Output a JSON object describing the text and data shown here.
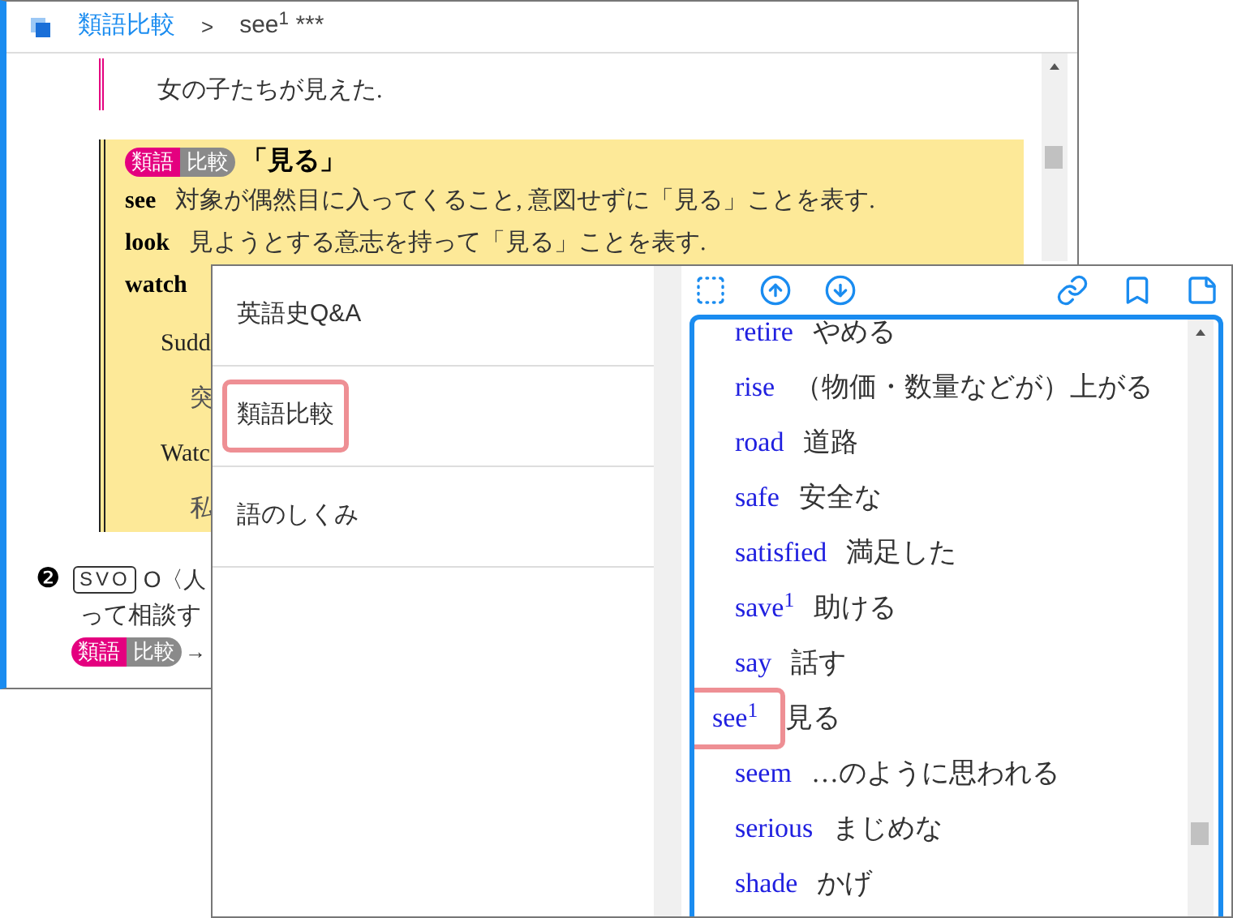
{
  "back_window": {
    "breadcrumb": {
      "parent": "類語比較",
      "separator": ">",
      "current": "see$^{1}$ ***"
    },
    "example_line": "女の子たちが見えた.",
    "comparison": {
      "badge": {
        "left": "類語",
        "right": "比較"
      },
      "title": "「見る」",
      "rows": [
        {
          "word": "see",
          "text": "対象が偶然目に入ってくること, 意図せずに「見る」ことを表す."
        },
        {
          "word": "look",
          "text": "見ようとする意志を持って「見る」ことを表す."
        },
        {
          "word": "watch",
          "text": ""
        }
      ],
      "examples": [
        {
          "text": "Sudd",
          "kind": "english"
        },
        {
          "text": "突",
          "kind": "japanese"
        },
        {
          "text": "Watc",
          "kind": "english"
        },
        {
          "text": "私",
          "kind": "japanese"
        }
      ]
    },
    "sense": {
      "number": "❷",
      "pattern": "SVO",
      "line1": "O〈人",
      "line2": "って相談す",
      "badge": {
        "left": "類語",
        "right": "比較"
      },
      "arrow": "→"
    }
  },
  "front_window": {
    "menu": [
      {
        "label": "英語史Q&A",
        "selected": false
      },
      {
        "label": "類語比較",
        "selected": true
      },
      {
        "label": "語のしくみ",
        "selected": false
      }
    ],
    "words": [
      {
        "word": "retire",
        "meaning": "やめる",
        "selected": false
      },
      {
        "word": "rise",
        "meaning": "（物価・数量などが）上がる",
        "selected": false
      },
      {
        "word": "road",
        "meaning": "道路",
        "selected": false
      },
      {
        "word": "safe",
        "meaning": "安全な",
        "selected": false
      },
      {
        "word": "satisfied",
        "meaning": "満足した",
        "selected": false
      },
      {
        "word": "save$^{1}$",
        "meaning": "助ける",
        "selected": false
      },
      {
        "word": "say",
        "meaning": "話す",
        "selected": false
      },
      {
        "word": "see$^{1}$",
        "meaning": "見る",
        "selected": true
      },
      {
        "word": "seem",
        "meaning": "…のように思われる",
        "selected": false
      },
      {
        "word": "serious",
        "meaning": "まじめな",
        "selected": false
      },
      {
        "word": "shade",
        "meaning": "かげ",
        "selected": false
      }
    ]
  }
}
